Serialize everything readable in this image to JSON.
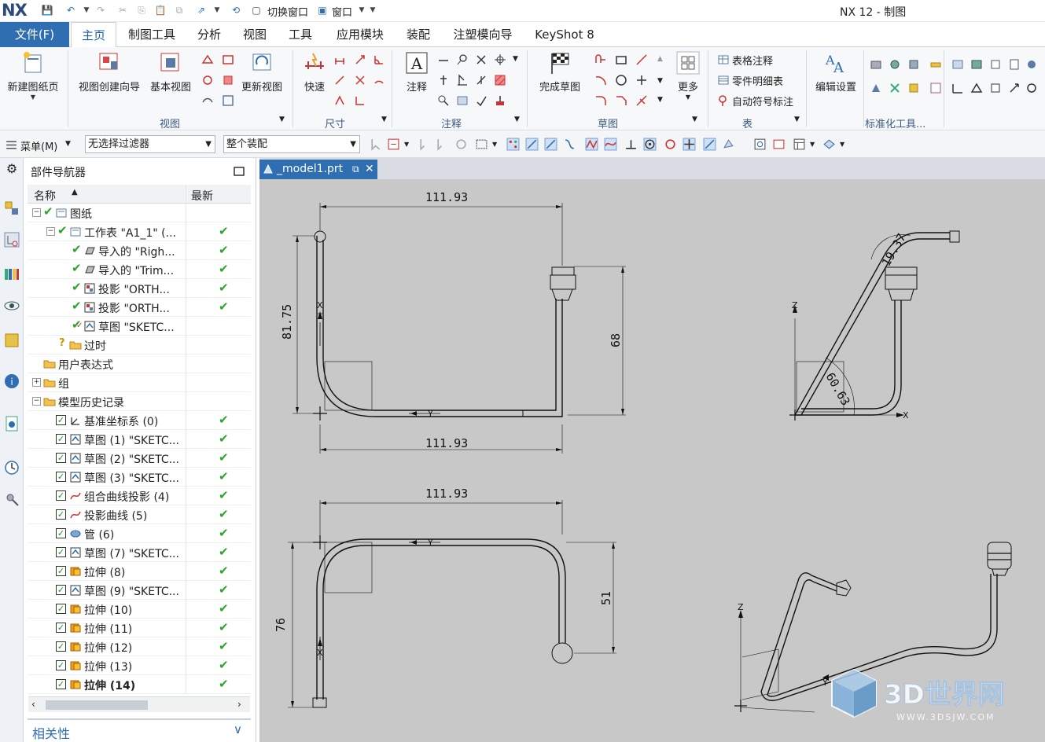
{
  "titlebar": {
    "logo": "NX",
    "app_title": "NX 12 - 制图",
    "switch_window": "切换窗口",
    "window": "窗口"
  },
  "tabs": {
    "file": "文件(F)",
    "items": [
      "主页",
      "制图工具",
      "分析",
      "视图",
      "工具",
      "应用模块",
      "装配",
      "注塑模向导",
      "KeyShot 8"
    ]
  },
  "ribbon": {
    "new_sheet": "新建图纸页",
    "view_wizard": "视图创建向导",
    "base_view": "基本视图",
    "update_view": "更新视图",
    "quick": "快速",
    "note": "注释",
    "finish_sketch": "完成草图",
    "more": "更多",
    "table_note": "表格注释",
    "parts_list": "零件明细表",
    "auto_balloon": "自动符号标注",
    "edit_settings": "编辑设置",
    "groups": {
      "view": "视图",
      "dimension": "尺寸",
      "annotation": "注释",
      "sketch": "草图",
      "table": "表",
      "standard_tools": "标准化工具..."
    }
  },
  "toolbar": {
    "menu": "菜单(M)",
    "filter": "无选择过滤器",
    "assembly": "整个装配"
  },
  "navigator": {
    "title": "部件导航器",
    "col_name": "名称",
    "col_latest": "最新",
    "rows": [
      {
        "label": "图纸",
        "check": ""
      },
      {
        "label": "工作表 \"A1_1\" (...",
        "check": "✔"
      },
      {
        "label": "导入的 \"Righ...",
        "check": "✔"
      },
      {
        "label": "导入的 \"Trim...",
        "check": "✔"
      },
      {
        "label": "投影 \"ORTH...",
        "check": "✔"
      },
      {
        "label": "投影 \"ORTH...",
        "check": "✔"
      },
      {
        "label": "草图 \"SKETC...",
        "check": ""
      },
      {
        "label": "过时",
        "check": ""
      },
      {
        "label": "用户表达式",
        "check": ""
      },
      {
        "label": "组",
        "check": ""
      },
      {
        "label": "模型历史记录",
        "check": ""
      },
      {
        "label": "基准坐标系 (0)",
        "check": "✔"
      },
      {
        "label": "草图 (1) \"SKETC...",
        "check": "✔"
      },
      {
        "label": "草图 (2) \"SKETC...",
        "check": "✔"
      },
      {
        "label": "草图 (3) \"SKETC...",
        "check": "✔"
      },
      {
        "label": "组合曲线投影 (4)",
        "check": "✔"
      },
      {
        "label": "投影曲线 (5)",
        "check": "✔"
      },
      {
        "label": "管 (6)",
        "check": "✔"
      },
      {
        "label": "草图 (7) \"SKETC...",
        "check": "✔"
      },
      {
        "label": "拉伸 (8)",
        "check": "✔"
      },
      {
        "label": "草图 (9) \"SKETC...",
        "check": "✔"
      },
      {
        "label": "拉伸 (10)",
        "check": "✔"
      },
      {
        "label": "拉伸 (11)",
        "check": "✔"
      },
      {
        "label": "拉伸 (12)",
        "check": "✔"
      },
      {
        "label": "拉伸 (13)",
        "check": "✔"
      },
      {
        "label": "拉伸 (14)",
        "check": "✔"
      }
    ],
    "related": "相关性"
  },
  "document": {
    "tab": "_model1.prt"
  },
  "drawing": {
    "dims": {
      "top_width": "111.93",
      "left_height": "81.75",
      "right_height": "68",
      "bottom_width": "111.93",
      "iso_angle_top": "19.37",
      "iso_angle": "60.63",
      "plan_width": "111.93",
      "plan_left": "76",
      "plan_right": "51"
    },
    "axis": {
      "z": "Z",
      "x": "X",
      "y": "Y"
    },
    "watermark": "3D世界网",
    "watermark_url": "WWW.3DSJW.COM"
  }
}
